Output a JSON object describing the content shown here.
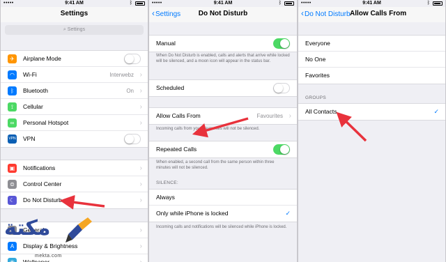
{
  "status_bar": {
    "carrier": "•••••",
    "time": "9:41 AM",
    "bluetooth_icon": "bluetooth-icon",
    "battery_icon": "battery-icon"
  },
  "screen1": {
    "title": "Settings",
    "search_placeholder": "Settings",
    "search_icon": "search-icon",
    "group1": [
      {
        "label": "Airplane Mode",
        "icon": "airplane-icon",
        "color": "#ff9500",
        "glyph": "✈",
        "control": "toggle",
        "on": false
      },
      {
        "label": "Wi-Fi",
        "icon": "wifi-icon",
        "color": "#007aff",
        "glyph": "◠",
        "value": "Interwebz"
      },
      {
        "label": "Bluetooth",
        "icon": "bluetooth-icon",
        "color": "#007aff",
        "glyph": "ᛒ",
        "value": "On"
      },
      {
        "label": "Cellular",
        "icon": "cellular-icon",
        "color": "#4cd964",
        "glyph": "⟟"
      },
      {
        "label": "Personal Hotspot",
        "icon": "hotspot-icon",
        "color": "#4cd964",
        "glyph": "∞"
      },
      {
        "label": "VPN",
        "icon": "vpn-icon",
        "color": "#0a5fb4",
        "glyph": "VPN",
        "control": "toggle",
        "on": false
      }
    ],
    "group2": [
      {
        "label": "Notifications",
        "icon": "notifications-icon",
        "color": "#ff3b30",
        "glyph": "▣"
      },
      {
        "label": "Control Center",
        "icon": "control-center-icon",
        "color": "#8e8e93",
        "glyph": "⊜"
      },
      {
        "label": "Do Not Disturb",
        "icon": "moon-icon",
        "color": "#5856d6",
        "glyph": "☾"
      }
    ],
    "group3": [
      {
        "label": "General",
        "icon": "gear-icon",
        "color": "#8e8e93",
        "glyph": "⚙"
      },
      {
        "label": "Display & Brightness",
        "icon": "brightness-icon",
        "color": "#007aff",
        "glyph": "A"
      },
      {
        "label": "Wallpaper",
        "icon": "wallpaper-icon",
        "color": "#34aadc",
        "glyph": "❀"
      }
    ]
  },
  "screen2": {
    "back_label": "Settings",
    "title": "Do Not Disturb",
    "manual_label": "Manual",
    "manual_on": true,
    "manual_note": "When Do Not Disturb is enabled, calls and alerts that arrive while locked will be silenced, and a moon icon will appear in the status bar.",
    "scheduled_label": "Scheduled",
    "scheduled_on": false,
    "allow_calls_label": "Allow Calls From",
    "allow_calls_value": "Favourites",
    "allow_calls_note": "Incoming calls from your Favourites will not be silenced.",
    "repeated_label": "Repeated Calls",
    "repeated_on": true,
    "repeated_note": "When enabled, a second call from the same person within three minutes will not be silenced.",
    "silence_header": "SILENCE:",
    "silence_options": [
      {
        "label": "Always",
        "checked": false
      },
      {
        "label": "Only while iPhone is locked",
        "checked": true
      }
    ],
    "silence_note": "Incoming calls and notifications will be silenced while iPhone is locked."
  },
  "screen3": {
    "back_label": "Do Not Disturb",
    "title": "Allow Calls From",
    "options": [
      {
        "label": "Everyone"
      },
      {
        "label": "No One"
      },
      {
        "label": "Favorites"
      }
    ],
    "groups_header": "GROUPS",
    "groups": [
      {
        "label": "All Contacts",
        "checked": true
      }
    ]
  },
  "colors": {
    "accent": "#007aff",
    "toggle_on": "#4cd964",
    "annotation_arrow": "#e8323c"
  },
  "watermark": {
    "text": "مكتة",
    "domain": "mekta.com"
  }
}
